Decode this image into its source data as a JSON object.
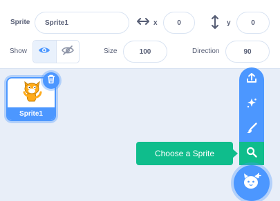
{
  "sprite_info": {
    "sprite_label": "Sprite",
    "sprite_name": "Sprite1",
    "x_label": "x",
    "x_value": "0",
    "y_label": "y",
    "y_value": "0",
    "show_label": "Show",
    "size_label": "Size",
    "size_value": "100",
    "direction_label": "Direction",
    "direction_value": "90",
    "icons": {
      "x_axis": "horizontal-arrows-icon",
      "y_axis": "vertical-arrows-icon",
      "show": "eye-icon",
      "hide": "eye-slash-icon"
    }
  },
  "sprite_list": [
    {
      "name": "Sprite1",
      "selected": true,
      "thumbnail": "cat-icon"
    }
  ],
  "sprite_menu": {
    "tooltip": "Choose a Sprite",
    "items": [
      {
        "icon": "upload-icon"
      },
      {
        "icon": "sparkle-icon"
      },
      {
        "icon": "paintbrush-icon"
      },
      {
        "icon": "search-icon"
      }
    ],
    "main_icon": "cat-add-icon"
  },
  "colors": {
    "accent": "#4c97ff",
    "active": "#0fbd8c",
    "text": "#575e75",
    "pane": "#e8eef8"
  }
}
